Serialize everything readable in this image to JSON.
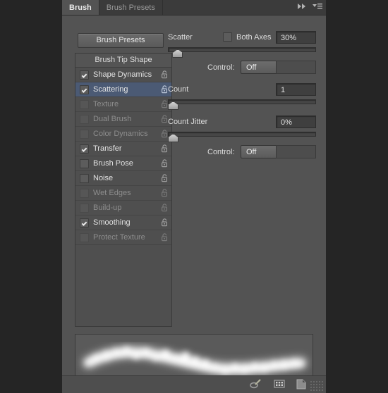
{
  "tabs": [
    {
      "label": "Brush",
      "active": true
    },
    {
      "label": "Brush Presets",
      "active": false
    }
  ],
  "tab_icons": {
    "collapse": "double-arrow-right-icon",
    "menu": "panel-menu-icon"
  },
  "preset_button": {
    "label": "Brush Presets"
  },
  "brush_list": {
    "header": "Brush Tip Shape",
    "items": [
      {
        "label": "Shape Dynamics",
        "checked": true,
        "enabled": true,
        "selected": false
      },
      {
        "label": "Scattering",
        "checked": true,
        "enabled": true,
        "selected": true
      },
      {
        "label": "Texture",
        "checked": false,
        "enabled": false,
        "selected": false
      },
      {
        "label": "Dual Brush",
        "checked": false,
        "enabled": false,
        "selected": false
      },
      {
        "label": "Color Dynamics",
        "checked": false,
        "enabled": false,
        "selected": false
      },
      {
        "label": "Transfer",
        "checked": true,
        "enabled": true,
        "selected": false
      },
      {
        "label": "Brush Pose",
        "checked": false,
        "enabled": true,
        "selected": false
      },
      {
        "label": "Noise",
        "checked": false,
        "enabled": true,
        "selected": false
      },
      {
        "label": "Wet Edges",
        "checked": false,
        "enabled": false,
        "selected": false
      },
      {
        "label": "Build-up",
        "checked": false,
        "enabled": false,
        "selected": false
      },
      {
        "label": "Smoothing",
        "checked": true,
        "enabled": true,
        "selected": false
      },
      {
        "label": "Protect Texture",
        "checked": false,
        "enabled": false,
        "selected": false
      }
    ]
  },
  "scattering": {
    "scatter": {
      "label": "Scatter",
      "value": "30%",
      "slider_percent": 3,
      "both_axes_label": "Both Axes",
      "both_axes_checked": false
    },
    "scatter_control": {
      "label": "Control:",
      "value": "Off"
    },
    "count": {
      "label": "Count",
      "value": "1",
      "slider_percent": 0
    },
    "count_jitter": {
      "label": "Count Jitter",
      "value": "0%",
      "slider_percent": 0
    },
    "count_jitter_control": {
      "label": "Control:",
      "value": "Off"
    }
  },
  "preview": {
    "name": "brush-stroke-preview"
  },
  "footer_icons": [
    {
      "name": "toggle-brush-options-icon"
    },
    {
      "name": "brush-presets-grid-icon"
    },
    {
      "name": "new-brush-preset-icon"
    }
  ],
  "colors": {
    "panel_bg": "#535353",
    "tab_bg": "#3b3b3b",
    "selection": "#4b5a74",
    "field_bg": "#3f3f3f",
    "app_bg": "#252525"
  }
}
